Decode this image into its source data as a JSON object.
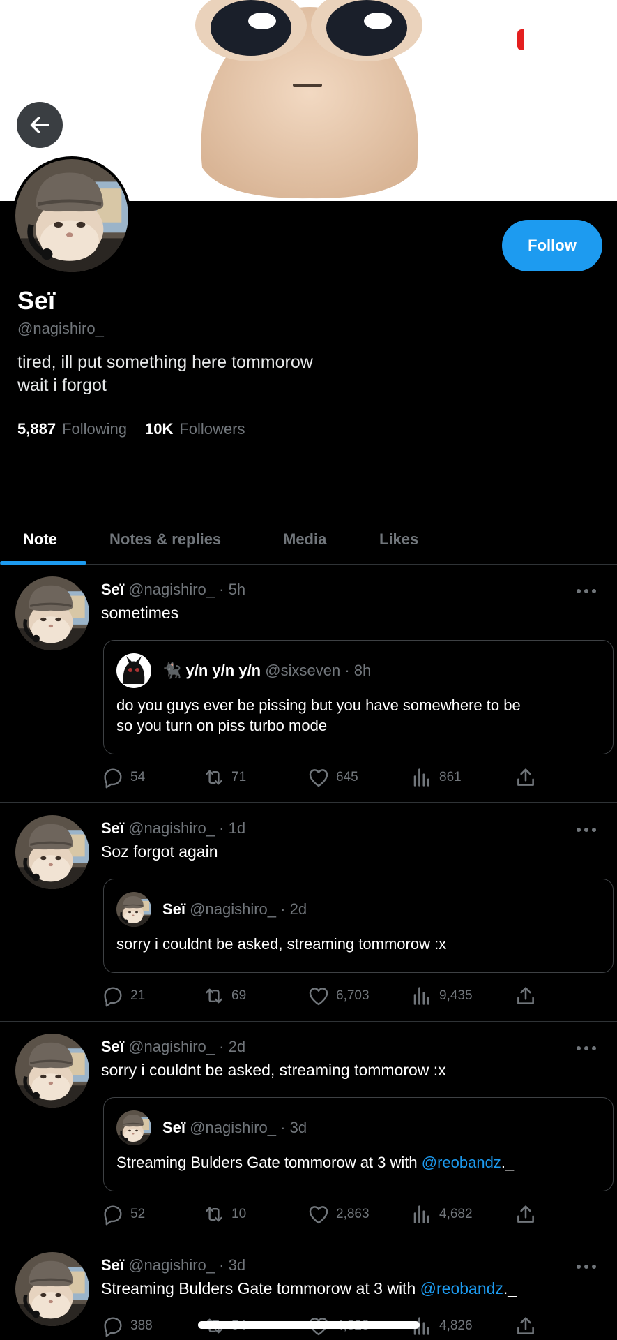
{
  "profile": {
    "display_name": "Seï",
    "handle": "@nagishiro_",
    "bio": "tired, ill put something here tommorow\nwait i forgot",
    "following_count": "5,887",
    "following_label": "Following",
    "followers_count": "10K",
    "followers_label": "Followers",
    "follow_button": "Follow"
  },
  "tabs": [
    "Note",
    "Notes & replies",
    "Media",
    "Likes"
  ],
  "posts": [
    {
      "name": "Seï",
      "handle": "@nagishiro_",
      "time": "· 5h",
      "text": "sometimes",
      "quote": {
        "emoji": "🐈‍⬛",
        "name": "y/n y/n y/n",
        "handle": "@sixseven",
        "time": "· 8h",
        "text": "do you guys ever be pissing but you have somewhere to be\nso you turn on piss turbo mode"
      },
      "replies": "54",
      "reposts": "71",
      "likes": "645",
      "views": "861"
    },
    {
      "name": "Seï",
      "handle": "@nagishiro_",
      "time": "· 1d",
      "text": "Soz forgot again",
      "quote": {
        "name": "Seï",
        "handle": "@nagishiro_",
        "time": "· 2d",
        "text": "sorry i couldnt be asked, streaming tommorow :x"
      },
      "replies": "21",
      "reposts": "69",
      "likes": "6,703",
      "views": "9,435"
    },
    {
      "name": "Seï",
      "handle": "@nagishiro_",
      "time": "· 2d",
      "text": "sorry i couldnt be asked, streaming tommorow :x",
      "quote": {
        "name": "Seï",
        "handle": "@nagishiro_",
        "time": "· 3d",
        "text_before": "Streaming Bulders Gate tommorow at 3 with ",
        "mention": "@reobandz",
        "text_after": "._"
      },
      "replies": "52",
      "reposts": "10",
      "likes": "2,863",
      "views": "4,682"
    },
    {
      "name": "Seï",
      "handle": "@nagishiro_",
      "time": "· 3d",
      "text_before": "Streaming Bulders Gate tommorow at 3 with ",
      "mention": "@reobandz",
      "text_after": "._",
      "replies": "388",
      "reposts": "54",
      "likes": "4,328",
      "views": "4,826"
    }
  ],
  "icons": {
    "back": "arrow-left-icon",
    "more": "more-dots-icon",
    "reply": "reply-bubble-icon",
    "repost": "repost-icon",
    "like": "heart-icon",
    "views": "views-bars-icon",
    "share": "share-upload-icon"
  },
  "colors": {
    "accent": "#1d9bf0",
    "background": "#000000",
    "muted": "#71767b"
  }
}
